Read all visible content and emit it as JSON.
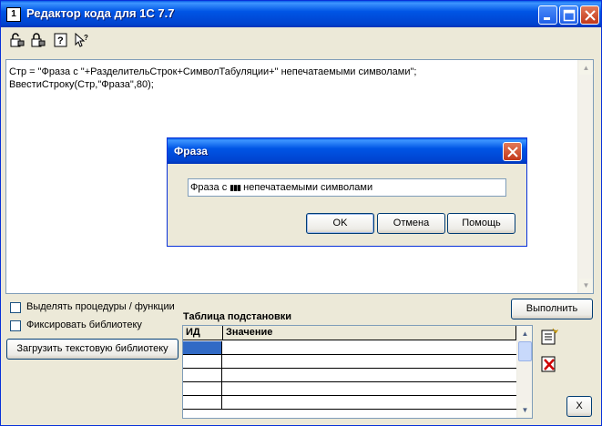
{
  "window": {
    "title": "Редактор кода для 1С 7.7",
    "app_icon_text": "1"
  },
  "toolbar": {
    "icons": [
      "unlock-icon",
      "lock-icon",
      "help-icon",
      "context-help-icon"
    ]
  },
  "editor": {
    "lines": [
      "Стр = \"Фраза с \"+РазделительСтрок+СимволТабуляции+\" непечатаемыми символами\";",
      "ВвестиСтроку(Стр,\"Фраза\",80);"
    ]
  },
  "dialog": {
    "title": "Фраза",
    "input_value_before": "Фраза с ",
    "input_value_marks": "▮▮▮",
    "input_value_after": " непечатаемыми символами",
    "ok_label": "OK",
    "cancel_label": "Отмена",
    "help_label": "Помощь"
  },
  "options": {
    "highlight_procedures_label": "Выделять процедуры / функции",
    "fix_library_label": "Фиксировать библиотеку",
    "load_library_label": "Загрузить текстовую библиотеку"
  },
  "table": {
    "title": "Таблица подстановки",
    "columns": [
      "ИД",
      "Значение"
    ]
  },
  "run_label": "Выполнить",
  "close_label": "X"
}
